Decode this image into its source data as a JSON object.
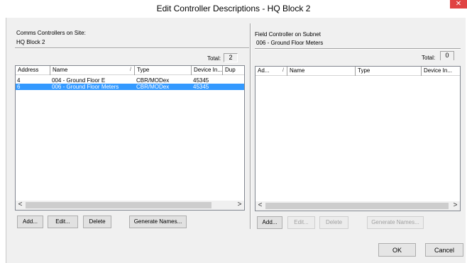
{
  "window": {
    "title": "Edit Controller Descriptions - HQ Block 2",
    "close_glyph": "✕"
  },
  "left": {
    "group_label": "Comms Controllers on Site:",
    "site_name": "HQ Block 2",
    "total_label": "Total:",
    "total_value": "2",
    "columns": [
      "Address",
      "Name",
      "Type",
      "Device In...",
      "Dup"
    ],
    "sort_indicator": "/",
    "rows": [
      {
        "address": "4",
        "name": "004 - Ground Floor E",
        "type": "CBR/MODex",
        "device": "45345",
        "selected": false
      },
      {
        "address": "6",
        "name": "006 - Ground Floor Meters",
        "type": "CBR/MODex",
        "device": "45345",
        "selected": true
      }
    ],
    "buttons": {
      "add": "Add...",
      "edit": "Edit...",
      "delete": "Delete",
      "generate": "Generate Names..."
    }
  },
  "right": {
    "group_label": "Field Controller on Subnet",
    "subnet_name": "006 - Ground Floor Meters",
    "total_label": "Total:",
    "total_value": "0",
    "columns": [
      "Ad...",
      "Name",
      "Type",
      "Device In..."
    ],
    "sort_indicator": "/",
    "buttons": {
      "add": "Add...",
      "edit": "Edit...",
      "delete": "Delete",
      "generate": "Generate Names..."
    }
  },
  "dialog": {
    "ok": "OK",
    "cancel": "Cancel"
  },
  "scroll": {
    "left_arrow": "<",
    "right_arrow": ">"
  }
}
